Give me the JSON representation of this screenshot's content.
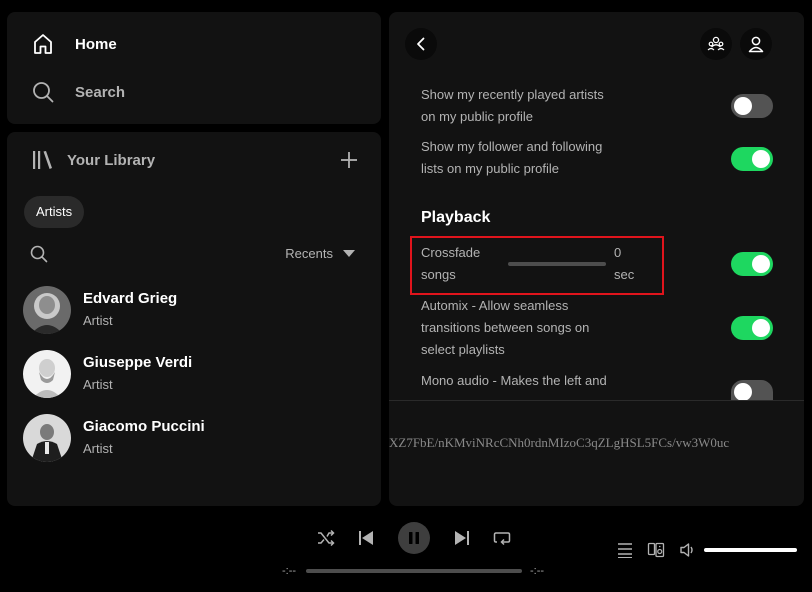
{
  "nav": {
    "home": "Home",
    "search": "Search"
  },
  "library": {
    "title": "Your Library",
    "filter_chip": "Artists",
    "sort_label": "Recents",
    "artists": [
      {
        "name": "Edvard Grieg",
        "type": "Artist"
      },
      {
        "name": "Giuseppe Verdi",
        "type": "Artist"
      },
      {
        "name": "Giacomo Puccini",
        "type": "Artist"
      }
    ]
  },
  "settings": {
    "items": [
      {
        "line1": "Show my recently played artists",
        "line2": "on my public profile",
        "enabled": false
      },
      {
        "line1": "Show my follower and following",
        "line2": "lists on my public profile",
        "enabled": true
      }
    ],
    "section_title": "Playback",
    "crossfade": {
      "line1": "Crossfade",
      "line2": "songs",
      "value": "0",
      "unit": "sec",
      "enabled": true
    },
    "automix": {
      "line1": "Automix - Allow seamless",
      "line2": "transitions between songs on",
      "line3": "select playlists",
      "enabled": true
    },
    "mono": {
      "line1": "Mono audio - Makes the left and",
      "enabled": false
    },
    "garbled_text": "XZ7FbE/nKMviNRcCNh0rdnMIzoC3qZLgHSL5FCs/vw3W0uc"
  },
  "player": {
    "elapsed": "-:--",
    "remaining": "-:--",
    "progress": 0,
    "volume": 1.0
  },
  "colors": {
    "accent_green": "#1ed760",
    "highlight_red": "#e0141c"
  }
}
